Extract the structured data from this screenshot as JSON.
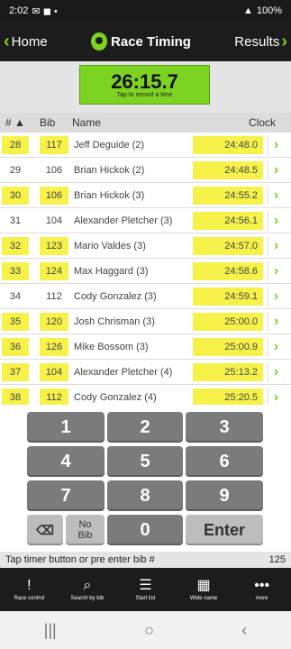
{
  "status_bar": {
    "time": "2:02",
    "battery": "100%"
  },
  "nav": {
    "back_label": "Home",
    "title": "Race Timing",
    "results_label": "Results"
  },
  "timer": {
    "value": "26:15.7",
    "hint": "Tap to record a time"
  },
  "table": {
    "headers": {
      "num": "# ▲",
      "bib": "Bib",
      "name": "Name",
      "clock": "Clock"
    },
    "rows": [
      {
        "num": "28",
        "bib": "117",
        "name": "Jeff Deguide (2)",
        "clock": "24:48.0",
        "hl_num": true,
        "hl_bib": true
      },
      {
        "num": "29",
        "bib": "106",
        "name": "Brian Hickok (2)",
        "clock": "24:48.5",
        "hl_num": false,
        "hl_bib": false
      },
      {
        "num": "30",
        "bib": "106",
        "name": "Brian Hickok (3)",
        "clock": "24:55.2",
        "hl_num": true,
        "hl_bib": true
      },
      {
        "num": "31",
        "bib": "104",
        "name": "Alexander Pletcher (3)",
        "clock": "24:56.1",
        "hl_num": false,
        "hl_bib": false
      },
      {
        "num": "32",
        "bib": "123",
        "name": "Mario Valdes (3)",
        "clock": "24:57.0",
        "hl_num": true,
        "hl_bib": true
      },
      {
        "num": "33",
        "bib": "124",
        "name": "Max Haggard (3)",
        "clock": "24:58.6",
        "hl_num": true,
        "hl_bib": true
      },
      {
        "num": "34",
        "bib": "112",
        "name": "Cody Gonzalez (3)",
        "clock": "24:59.1",
        "hl_num": false,
        "hl_bib": false
      },
      {
        "num": "35",
        "bib": "120",
        "name": "Josh Chrisman (3)",
        "clock": "25:00.0",
        "hl_num": true,
        "hl_bib": true
      },
      {
        "num": "36",
        "bib": "126",
        "name": "Mike Bossom (3)",
        "clock": "25:00.9",
        "hl_num": true,
        "hl_bib": true
      },
      {
        "num": "37",
        "bib": "104",
        "name": "Alexander Pletcher (4)",
        "clock": "25:13.2",
        "hl_num": true,
        "hl_bib": true
      },
      {
        "num": "38",
        "bib": "112",
        "name": "Cody Gonzalez (4)",
        "clock": "25:20.5",
        "hl_num": true,
        "hl_bib": true
      }
    ]
  },
  "keypad": {
    "digits": [
      "1",
      "2",
      "3",
      "4",
      "5",
      "6",
      "7",
      "8",
      "9",
      "0"
    ],
    "backspace": "⌫",
    "no_bib_line1": "No",
    "no_bib_line2": "Bib",
    "enter": "Enter"
  },
  "info": {
    "message": "Tap timer button or pre enter bib #",
    "count": "125"
  },
  "tabs": [
    {
      "icon": "!",
      "label": "Race control"
    },
    {
      "icon": "⌕",
      "label": "Search by bib"
    },
    {
      "icon": "☰",
      "label": "Start list"
    },
    {
      "icon": "▦",
      "label": "Wide name"
    },
    {
      "icon": "•••",
      "label": "more"
    }
  ],
  "colors": {
    "accent": "#7dd321",
    "highlight": "#f6f24a",
    "dark": "#1c1c1c"
  }
}
